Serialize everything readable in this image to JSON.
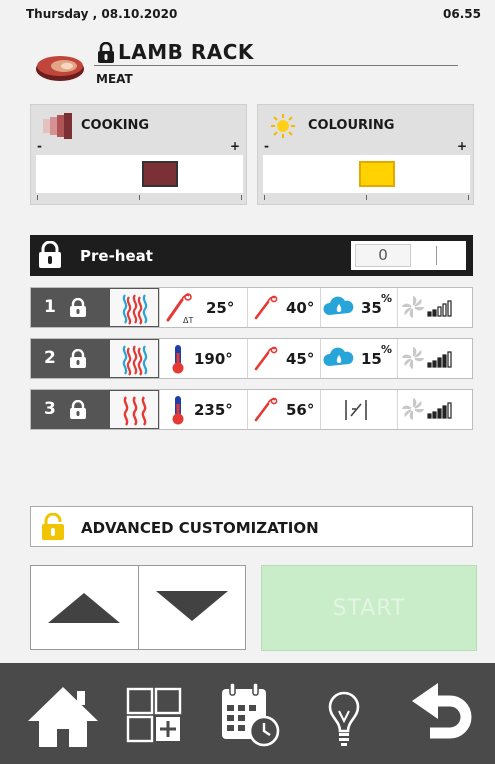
{
  "status": {
    "date": "Thursday , 08.10.2020",
    "time": "06.55"
  },
  "header": {
    "title": "LAMB RACK",
    "category": "MEAT",
    "icon": "meat-icon",
    "locked": true
  },
  "cooking": {
    "label": "COOKING",
    "minus": "-",
    "plus": "+",
    "level": 0.6,
    "color": "#7b3035",
    "icon": "cooking-level-icon"
  },
  "colouring": {
    "label": "COLOURING",
    "minus": "-",
    "plus": "+",
    "level": 0.55,
    "color": "#ffd200",
    "icon": "sun-icon"
  },
  "preheat": {
    "label": "Pre-heat",
    "value": "0"
  },
  "phases": [
    {
      "number": "1",
      "mode": "combi-steam",
      "temp_label": "25°",
      "temp_type": "delta-t-probe",
      "core_label": "40°",
      "humidity_label": "35",
      "humidity_unit": "%",
      "fan_level": 2
    },
    {
      "number": "2",
      "mode": "combi-steam",
      "temp_label": "190°",
      "temp_type": "thermometer",
      "core_label": "45°",
      "humidity_label": "15",
      "humidity_unit": "%",
      "fan_level": 4
    },
    {
      "number": "3",
      "mode": "convection",
      "temp_label": "235°",
      "temp_type": "thermometer",
      "core_label": "56°",
      "humidity_label": "",
      "humidity_unit": "",
      "fan_level": 4
    }
  ],
  "advanced": {
    "label": "ADVANCED CUSTOMIZATION"
  },
  "start": {
    "label": "START"
  },
  "footer": {
    "items": [
      "home-icon",
      "add-program-icon",
      "calendar-schedule-icon",
      "lightbulb-icon",
      "back-icon"
    ]
  },
  "colors": {
    "accent_red": "#e53935",
    "steam_blue": "#27a5d8",
    "lock_yellow": "#f0c400",
    "footer_bg": "#4a4a4a",
    "start_bg": "#c9ecc9"
  }
}
